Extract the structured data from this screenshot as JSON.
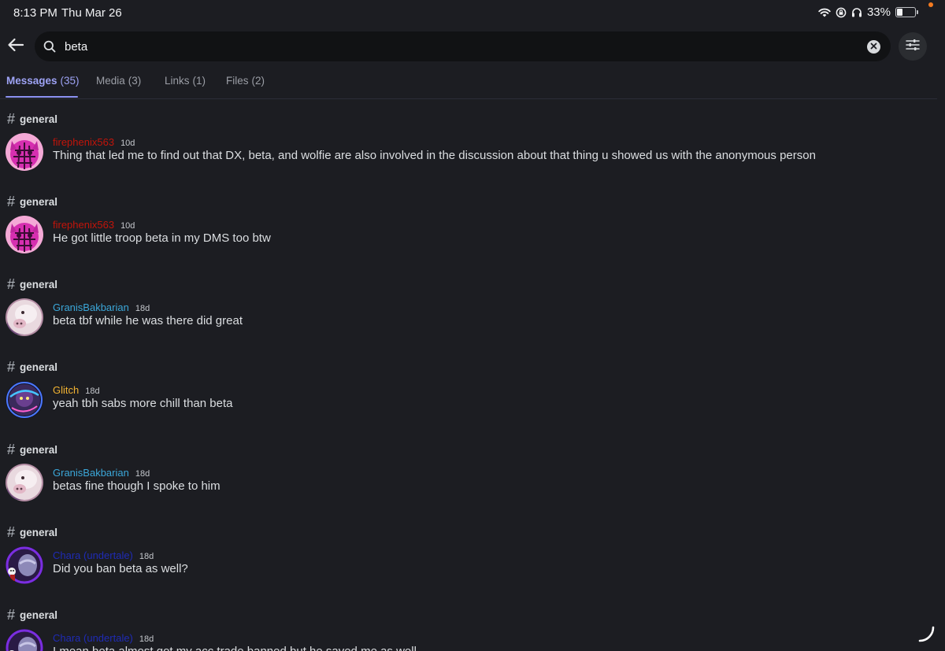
{
  "status_bar": {
    "time": "8:13 PM",
    "date": "Thu Mar 26",
    "battery_percent": "33%",
    "battery_level": 0.33
  },
  "search": {
    "query": "beta",
    "placeholder": "Search"
  },
  "tabs": [
    {
      "label": "Messages",
      "count": "(35)",
      "active": true
    },
    {
      "label": "Media",
      "count": "(3)",
      "active": false
    },
    {
      "label": "Links",
      "count": "(1)",
      "active": false
    },
    {
      "label": "Files",
      "count": "(2)",
      "active": false
    }
  ],
  "results": [
    {
      "channel": "general",
      "author": "firephenix563",
      "author_color": "#c2140a",
      "time": "10d",
      "avatar": "pink-cat",
      "text": "Thing that led me to find out that DX, beta, and wolfie are also involved in the discussion about that thing u showed us with the anonymous person"
    },
    {
      "channel": "general",
      "author": "firephenix563",
      "author_color": "#c2140a",
      "time": "10d",
      "avatar": "pink-cat",
      "text": "He got little troop beta in my DMS too btw"
    },
    {
      "channel": "general",
      "author": "GranisBakbarian",
      "author_color": "#3ba7d9",
      "time": "18d",
      "avatar": "pig",
      "text": "beta tbf while he was there did great"
    },
    {
      "channel": "general",
      "author": "Glitch",
      "author_color": "#f0b232",
      "time": "18d",
      "avatar": "glitch",
      "text": "yeah tbh sabs more chill than beta"
    },
    {
      "channel": "general",
      "author": "GranisBakbarian",
      "author_color": "#3ba7d9",
      "time": "18d",
      "avatar": "pig",
      "text": "betas fine though I spoke to him"
    },
    {
      "channel": "general",
      "author": "Chara (undertale)",
      "author_color": "#1f2bb5",
      "time": "18d",
      "avatar": "chara",
      "text": "Did you ban beta as well?"
    },
    {
      "channel": "general",
      "author": "Chara (undertale)",
      "author_color": "#1f2bb5",
      "time": "18d",
      "avatar": "chara",
      "text": "I mean beta almost got my acc trade banned but he saved me as well"
    }
  ],
  "icons": {
    "back": "arrow-left-icon",
    "search": "search-icon",
    "clear": "clear-x-icon",
    "filter": "sliders-icon",
    "channel": "hash-icon"
  }
}
